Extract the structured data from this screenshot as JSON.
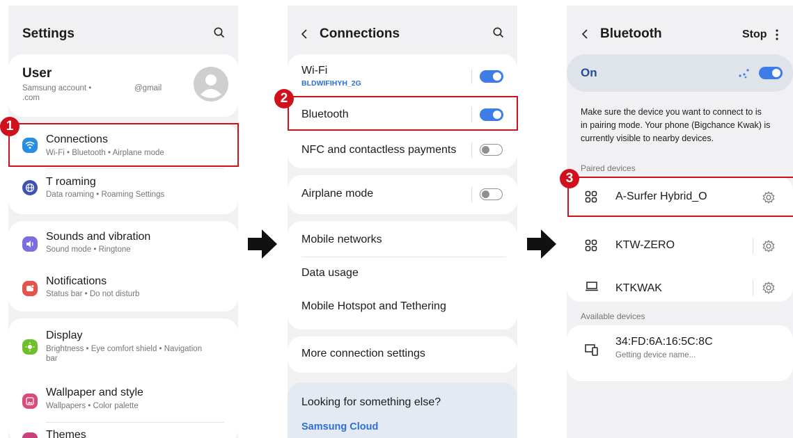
{
  "panel1": {
    "title": "Settings",
    "profile": {
      "name": "User",
      "account_line1": "Samsung account •",
      "account_email": "@gmail",
      "account_line2": ".com"
    },
    "items": [
      {
        "label": "Connections",
        "sub": "Wi-Fi • Bluetooth • Airplane mode",
        "icon_color": "#2a8de1"
      },
      {
        "label": "T roaming",
        "sub": "Data roaming • Roaming Settings",
        "icon_color": "#3d52b3"
      },
      {
        "label": "Sounds and vibration",
        "sub": "Sound mode • Ringtone",
        "icon_color": "#7a6ee0"
      },
      {
        "label": "Notifications",
        "sub": "Status bar • Do not disturb",
        "icon_color": "#e5544b"
      },
      {
        "label": "Display",
        "sub": "Brightness • Eye comfort shield • Navigation",
        "sub2": "bar",
        "icon_color": "#6fbf2c"
      },
      {
        "label": "Wallpaper and style",
        "sub": "Wallpapers • Color palette",
        "icon_color": "#d84c7d"
      },
      {
        "label": "Themes",
        "icon_color": "#c9427a"
      }
    ]
  },
  "panel2": {
    "title": "Connections",
    "wifi": {
      "label": "Wi-Fi",
      "network": "BLDWIFIHYH_2G",
      "on": true
    },
    "bluetooth": {
      "label": "Bluetooth",
      "on": true
    },
    "nfc": {
      "label": "NFC and contactless payments",
      "on": false
    },
    "airplane": {
      "label": "Airplane mode",
      "on": false
    },
    "mobile_networks": "Mobile networks",
    "data_usage": "Data usage",
    "hotspot": "Mobile Hotspot and Tethering",
    "more": "More connection settings",
    "looking": "Looking for something else?",
    "samsung_cloud": "Samsung Cloud"
  },
  "panel3": {
    "title": "Bluetooth",
    "stop": "Stop",
    "on_label": "On",
    "info": [
      "Make sure the device you want to connect to is",
      "in pairing mode. Your phone (Bigchance Kwak) is",
      "currently visible to nearby devices."
    ],
    "paired_header": "Paired devices",
    "paired": [
      {
        "name": "A-Surfer Hybrid_O",
        "icon": "earbuds-icon"
      },
      {
        "name": "KTW-ZERO",
        "icon": "earbuds-icon"
      },
      {
        "name": "KTKWAK",
        "icon": "laptop-icon"
      }
    ],
    "available_header": "Available devices",
    "available": [
      {
        "name": "34:FD:6A:16:5C:8C",
        "sub": "Getting device name...",
        "icon": "devices-icon"
      }
    ]
  },
  "badges": [
    "1",
    "2",
    "3"
  ],
  "colors": {
    "accent": "#3e7de6",
    "highlight": "#d0111b",
    "panel_bg": "#f1f1f3"
  }
}
